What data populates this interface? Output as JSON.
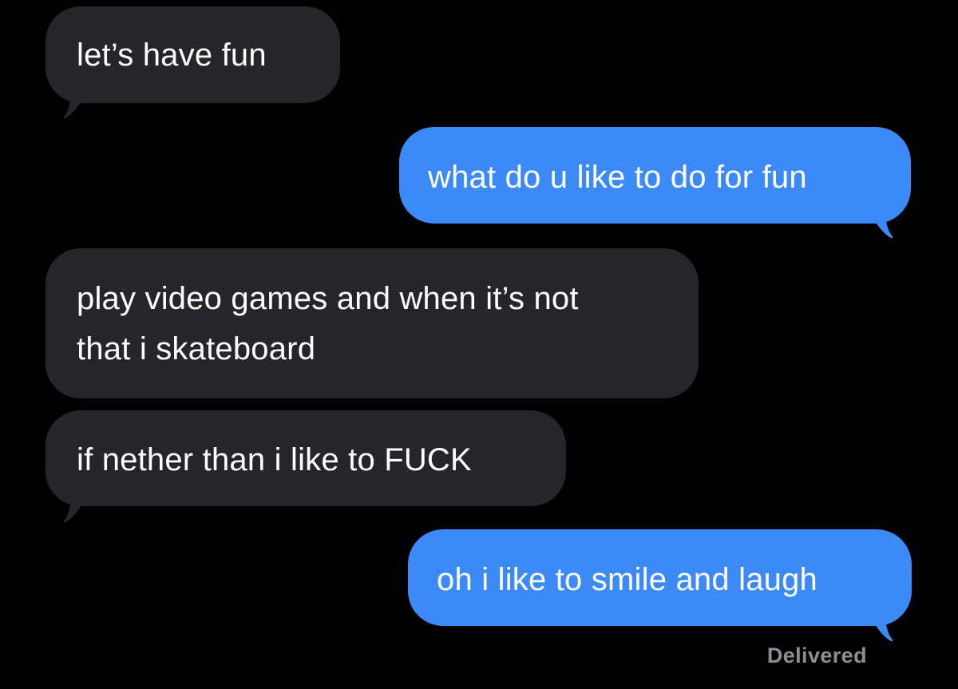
{
  "messages": [
    {
      "direction": "received",
      "text": "let’s have fun"
    },
    {
      "direction": "sent",
      "text": "what do u like to do for fun"
    },
    {
      "direction": "received",
      "lines": [
        "play video games and when it’s not",
        "that i skateboard"
      ]
    },
    {
      "direction": "received",
      "text": "if nether than i like to FUCK"
    },
    {
      "direction": "sent",
      "text": "oh i like to smile and laugh"
    }
  ],
  "status": {
    "delivered": "Delivered"
  },
  "colors": {
    "background": "#000000",
    "received_bubble": "#26252a",
    "sent_bubble": "#3c8af7",
    "bubble_text": "#ffffff",
    "status_text": "#8d8d93"
  }
}
